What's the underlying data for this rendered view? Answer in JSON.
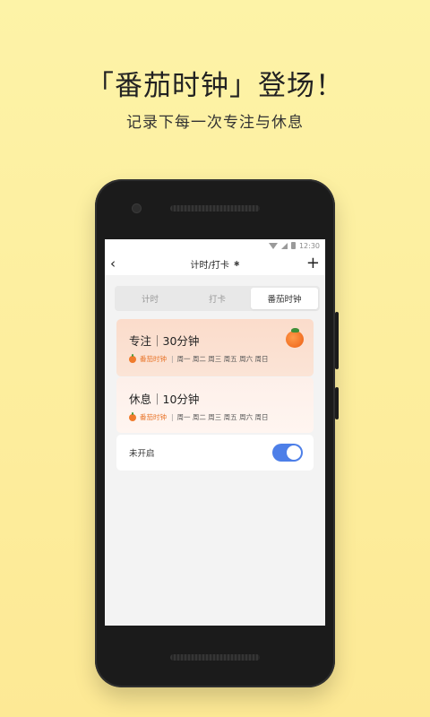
{
  "promo": {
    "title": "「番茄时钟」登场！",
    "subtitle": "记录下每一次专注与休息"
  },
  "status_bar": {
    "time": "12:30",
    "icons": [
      "wifi-icon",
      "signal-icon",
      "battery-icon"
    ]
  },
  "header": {
    "title": "计时/打卡",
    "title_icon": "bluetooth-icon",
    "back_icon": "back-icon",
    "add_icon": "add-icon"
  },
  "tabs": [
    {
      "label": "计时",
      "active": false
    },
    {
      "label": "打卡",
      "active": false
    },
    {
      "label": "番茄时钟",
      "active": true
    }
  ],
  "cards": [
    {
      "title": "专注｜30分钟",
      "tag": "番茄时钟",
      "sep": "|",
      "days": "周一 周二 周三 周五 周六 周日",
      "icon": "tomato-icon"
    },
    {
      "title": "休息｜10分钟",
      "tag": "番茄时钟",
      "sep": "|",
      "days": "周一 周二 周三 周五 周六 周日"
    }
  ],
  "toggle": {
    "label": "未开启",
    "on": true
  },
  "colors": {
    "background": "#fdf0a0",
    "accent_orange": "#e8752b",
    "toggle_blue": "#4d7fe8",
    "focus_card": "#fbdccb",
    "rest_card": "#fdf0ea"
  }
}
